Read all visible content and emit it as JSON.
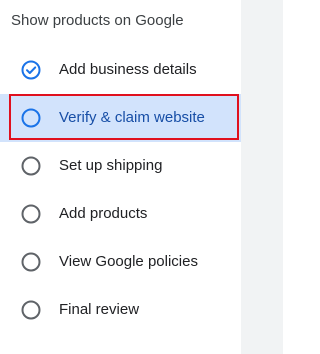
{
  "heading": "Show products on Google",
  "steps": [
    {
      "label": "Add business details",
      "state": "completed",
      "icon": "check-circle-icon"
    },
    {
      "label": "Verify & claim website",
      "state": "active",
      "icon": "circle-outline-icon"
    },
    {
      "label": "Set up shipping",
      "state": "pending",
      "icon": "circle-outline-icon"
    },
    {
      "label": "Add products",
      "state": "pending",
      "icon": "circle-outline-icon"
    },
    {
      "label": "View Google policies",
      "state": "pending",
      "icon": "circle-outline-icon"
    },
    {
      "label": "Final review",
      "state": "pending",
      "icon": "circle-outline-icon"
    }
  ],
  "colors": {
    "accent": "#1a73e8",
    "active_bg": "#d2e3fc",
    "highlight_border": "#e0101e",
    "pending_icon": "#5f6368"
  }
}
